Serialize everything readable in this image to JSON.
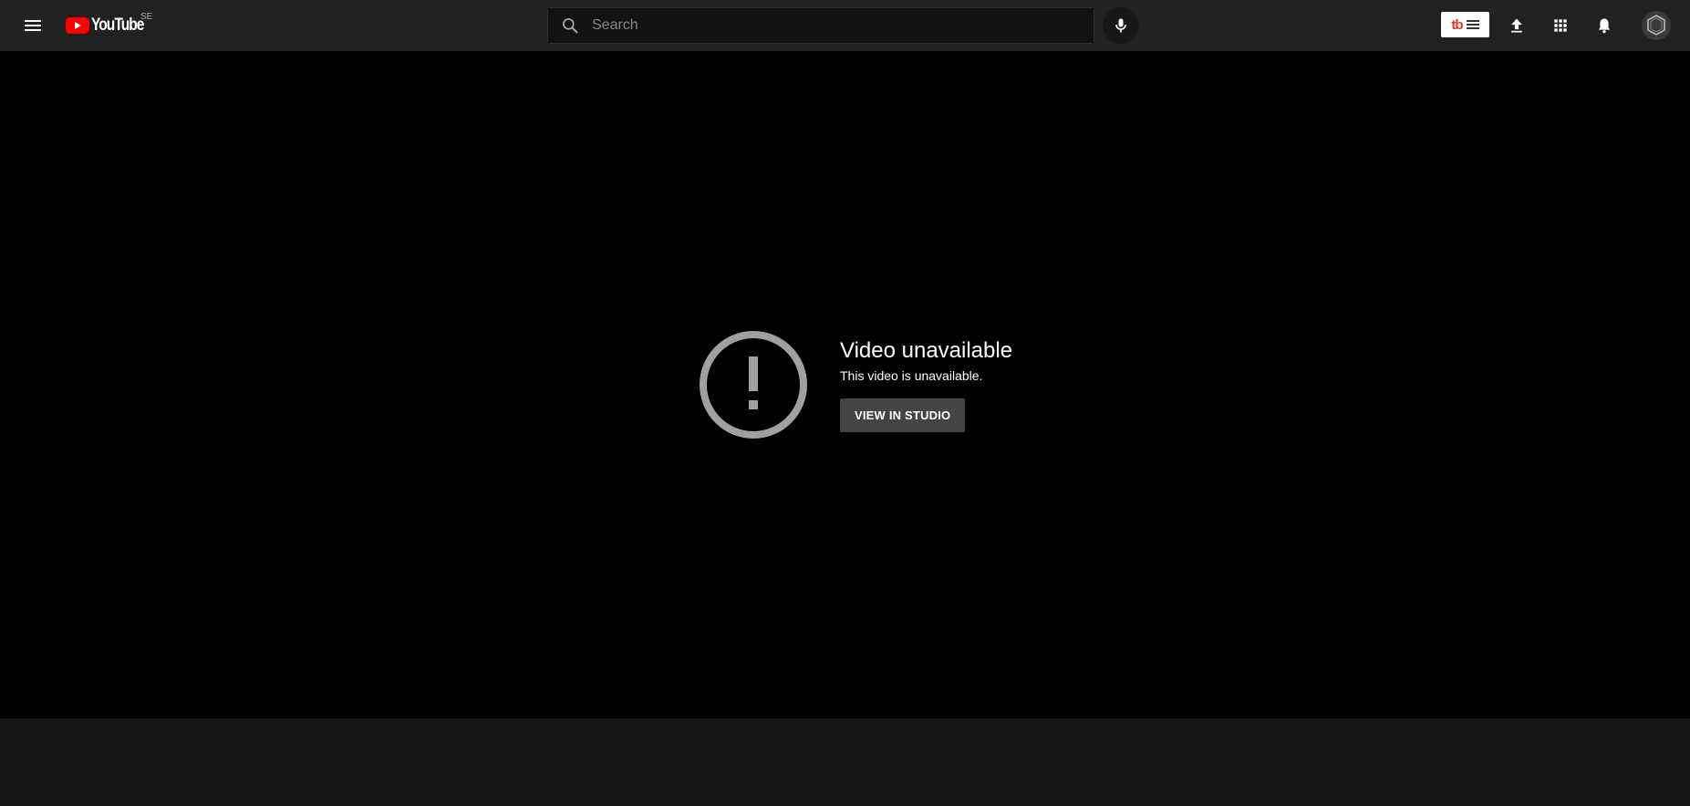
{
  "header": {
    "logo_text": "YouTube",
    "logo_country": "SE",
    "search": {
      "placeholder": "Search",
      "value": ""
    },
    "icons": {
      "menu": "hamburger-menu-icon",
      "search": "search-icon",
      "mic": "microphone-icon",
      "extension": "tubebuddy-icon",
      "upload": "upload-icon",
      "apps": "apps-grid-icon",
      "notifications": "bell-icon",
      "avatar": "avatar"
    }
  },
  "player": {
    "error_title": "Video unavailable",
    "error_subtitle": "This video is unavailable.",
    "action_label": "VIEW IN STUDIO"
  },
  "colors": {
    "brand_red": "#ff0000",
    "masthead_bg": "#212121",
    "player_bg": "#000000",
    "error_icon": "#a0a0a0",
    "button_bg": "#444444"
  }
}
